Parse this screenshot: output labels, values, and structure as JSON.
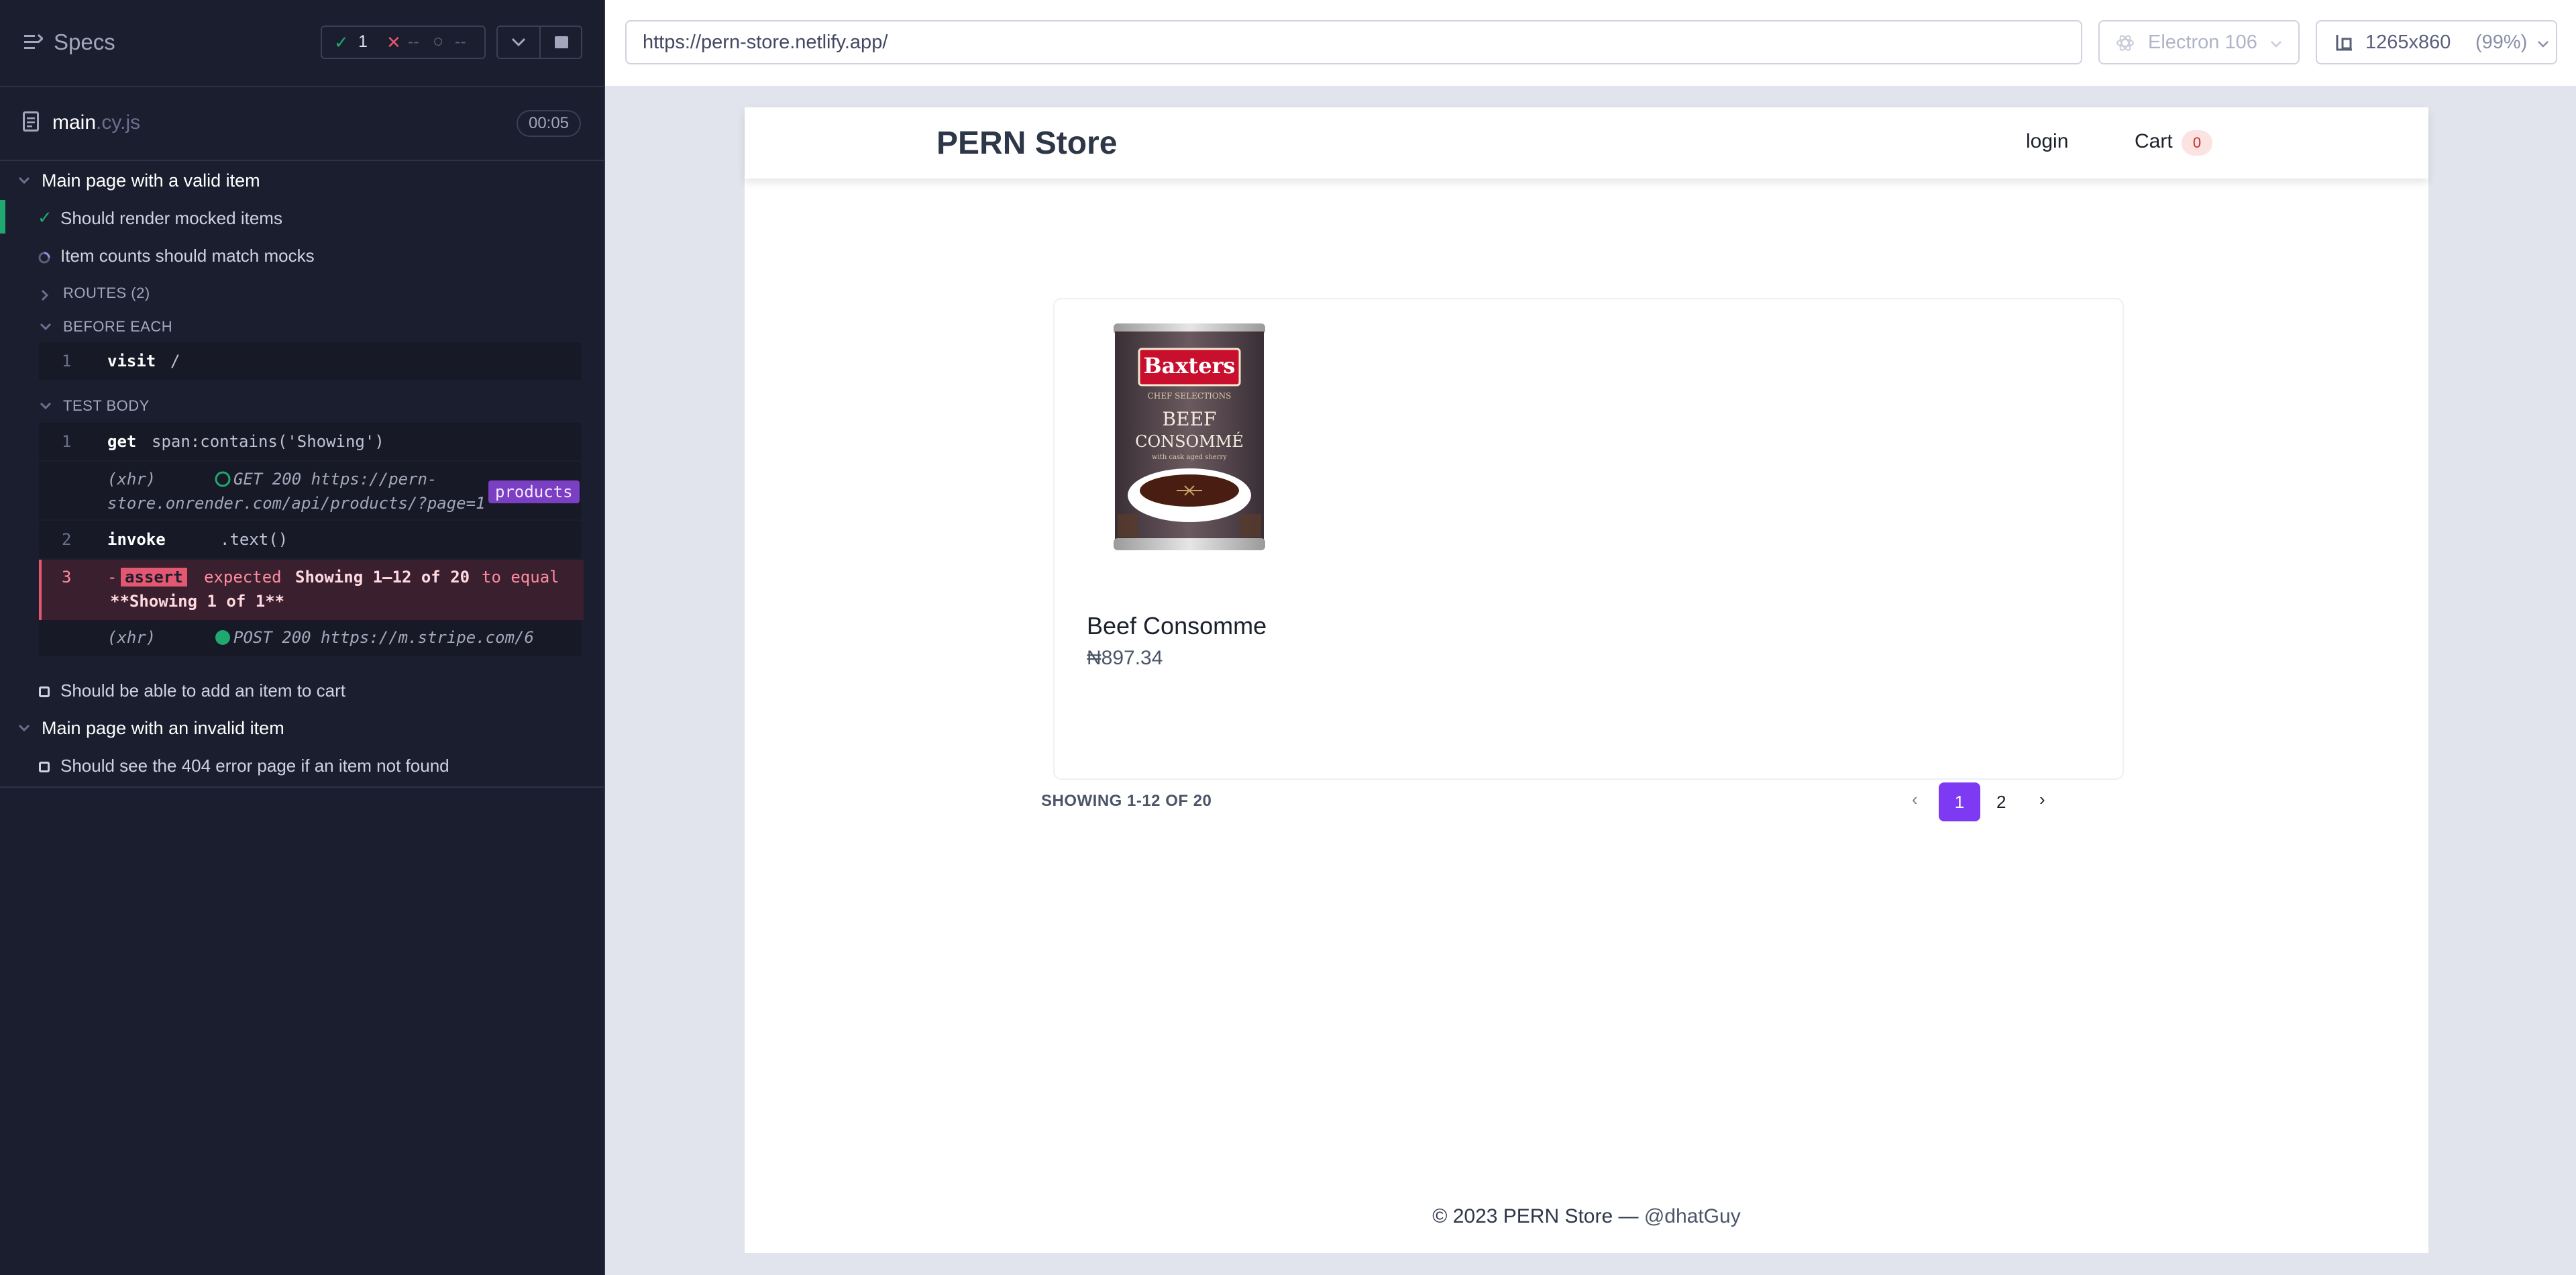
{
  "reporter": {
    "header": {
      "title": "Specs",
      "passed_count": "1",
      "failed_count": "--",
      "pending_count": "--"
    },
    "spec_file": {
      "name": "main",
      "extension": ".cy.js",
      "duration": "00:05"
    },
    "suite1": {
      "title": "Main page with a valid item",
      "test1": "Should render mocked items",
      "test2": "Item counts should match mocks",
      "routes_label": "ROUTES (2)",
      "before_each_label": "BEFORE EACH",
      "before_each_cmd": {
        "num": "1",
        "name": "visit",
        "msg": "/"
      },
      "test_body_label": "TEST BODY",
      "cmd1": {
        "num": "1",
        "name": "get",
        "msg": "span:contains('Showing')"
      },
      "xhr1": {
        "tag": "(xhr)",
        "line1": "GET 200 https://pern-",
        "line2": "store.onrender.com/api/products/?page=1",
        "alias": "products"
      },
      "cmd2": {
        "num": "2",
        "name": "invoke",
        "msg": ".text()"
      },
      "cmd3": {
        "num": "3",
        "prefix": "-",
        "badge": "assert",
        "expected": "expected",
        "actual": "Showing 1–12 of 20",
        "to_equal": "to equal",
        "line2": "**Showing 1 of 1**"
      },
      "xhr2": {
        "tag": "(xhr)",
        "text": "POST 200 https://m.stripe.com/6"
      },
      "test3": "Should be able to add an item to cart"
    },
    "suite2": {
      "title": "Main page with an invalid item",
      "test1": "Should see the 404 error page if an item not found"
    }
  },
  "browser": {
    "url": "https://pern-store.netlify.app/",
    "engine": "Electron 106",
    "viewport": "1265x860",
    "zoom": "(99%)"
  },
  "app": {
    "brand": "PERN Store",
    "nav": {
      "login": "login",
      "cart": "Cart",
      "cart_count": "0"
    },
    "product": {
      "name": "Beef Consomme",
      "price": "₦897.34",
      "image_caption": "Baxters Beef Consommé"
    },
    "pagination": {
      "showing": "SHOWING 1-12 OF 20",
      "pages": [
        "1",
        "2"
      ],
      "current": "1"
    },
    "footer": {
      "copyright": "© 2023 PERN Store — ",
      "handle": "@dhatGuy"
    }
  },
  "colors": {
    "reporter_bg": "#1b1e2e",
    "pass": "#1fa971",
    "fail": "#e45770",
    "alias_purple": "#7b3fc4",
    "page_active": "#7e3af2",
    "aut_bg": "#e1e3ed"
  },
  "icons": [
    "specs-list-icon",
    "check-icon",
    "x-icon",
    "spinner-icon",
    "chevron-down-icon",
    "stop-icon",
    "file-icon",
    "chevron-right-icon",
    "circle-icon",
    "checkbox-icon",
    "electron-icon",
    "viewport-icon",
    "chevron-left-icon"
  ]
}
